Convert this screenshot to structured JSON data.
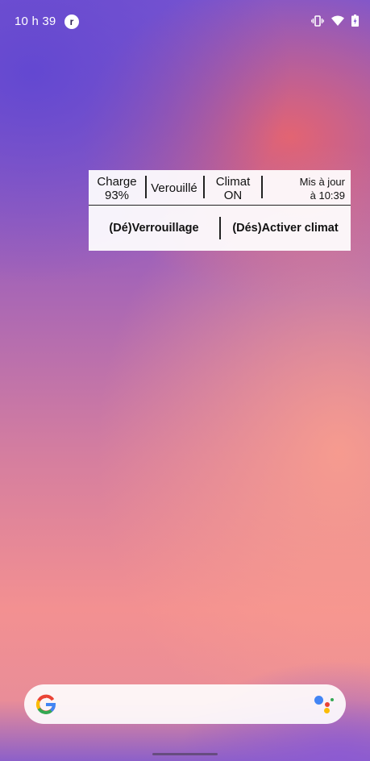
{
  "status_bar": {
    "time": "10 h 39",
    "icons": [
      "notification-app-icon",
      "vibrate-icon",
      "wifi-icon",
      "battery-icon"
    ]
  },
  "widget": {
    "charge_label": "Charge",
    "charge_value": "93%",
    "lock_status": "Verouillé",
    "climat_label": "Climat",
    "climat_value": "ON",
    "update_label": "Mis à jour",
    "update_time": "à 10:39",
    "lock_button": "(Dé)Verrouillage",
    "climat_button": "(Dés)Activer climat"
  },
  "search": {
    "icons": [
      "google-logo-icon",
      "google-assistant-icon"
    ]
  },
  "colors": {
    "google_blue": "#4285f4",
    "google_red": "#ea4335",
    "google_yellow": "#fbbc05",
    "google_green": "#34a853"
  }
}
